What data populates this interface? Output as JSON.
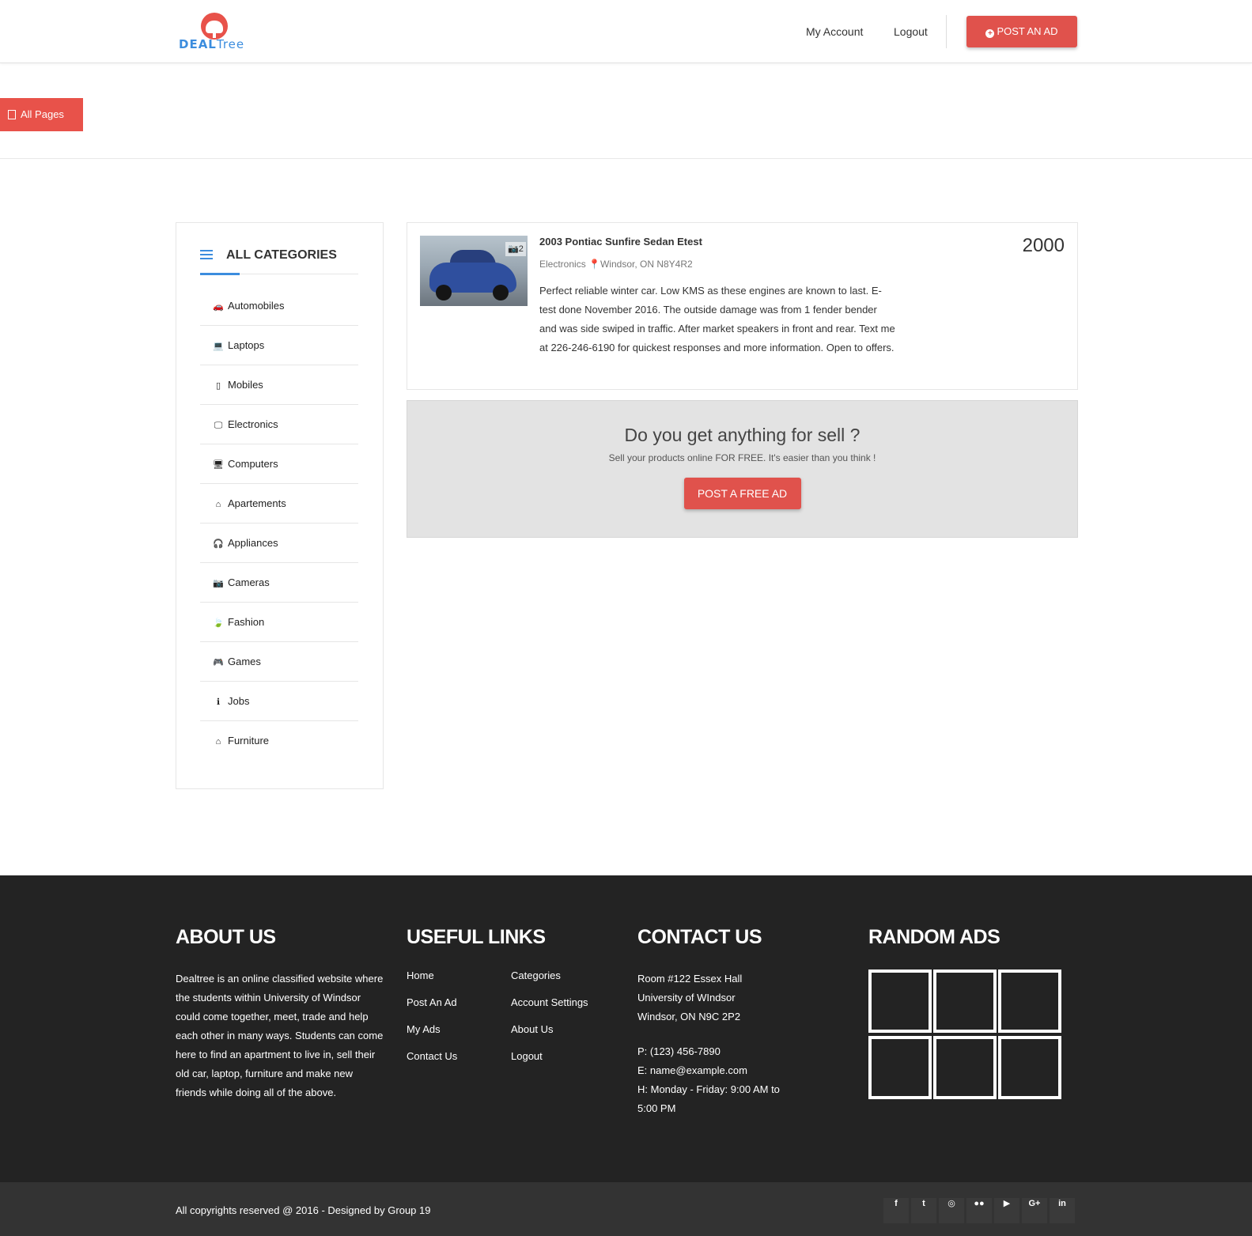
{
  "header": {
    "logo_deal": "DEAL",
    "logo_tree": "Tree",
    "my_account": "My Account",
    "logout": "Logout",
    "post_ad": "POST AN AD"
  },
  "all_pages": "All Pages",
  "sidebar": {
    "title": "ALL CATEGORIES",
    "categories": [
      {
        "icon": "car-icon",
        "glyph": "🚗",
        "label": "Automobiles"
      },
      {
        "icon": "laptop-icon",
        "glyph": "💻",
        "label": "Laptops"
      },
      {
        "icon": "mobile-icon",
        "glyph": "▯",
        "label": "Mobiles"
      },
      {
        "icon": "monitor-icon",
        "glyph": "🖵",
        "label": "Electronics"
      },
      {
        "icon": "desktop-icon",
        "glyph": "🖥",
        "label": "Computers"
      },
      {
        "icon": "home-icon",
        "glyph": "⌂",
        "label": "Apartements"
      },
      {
        "icon": "headphones-icon",
        "glyph": "🎧",
        "label": "Appliances"
      },
      {
        "icon": "camera-icon",
        "glyph": "📷",
        "label": "Cameras"
      },
      {
        "icon": "leaf-icon",
        "glyph": "🍃",
        "label": "Fashion"
      },
      {
        "icon": "gamepad-icon",
        "glyph": "🎮",
        "label": "Games"
      },
      {
        "icon": "info-icon",
        "glyph": "ℹ",
        "label": "Jobs"
      },
      {
        "icon": "home-icon",
        "glyph": "⌂",
        "label": "Furniture"
      }
    ]
  },
  "listing": {
    "title": "2003 Pontiac Sunfire Sedan Etest",
    "category": "Electronics",
    "location": "Windsor, ON N8Y4R2",
    "description": "Perfect reliable winter car. Low KMS as these engines are known to last. E-test done November 2016. The outside damage was from 1 fender bender and was side swiped in traffic. After market speakers in front and rear. Text me at 226-246-6190 for quickest responses and more information. Open to offers.",
    "price": "2000",
    "photo_count": "2"
  },
  "promo": {
    "title": "Do you get anything for sell ?",
    "subtitle": "Sell your products online FOR FREE. It's easier than you think !",
    "button": "POST A FREE AD"
  },
  "footer": {
    "about_title": "ABOUT US",
    "about_text": "Dealtree is an online classified website where the students within University of Windsor could come together, meet, trade and help each other in many ways. Students can come here to find an apartment to live in, sell their old car, laptop, furniture and make new friends while doing all of the above.",
    "links_title": "USEFUL LINKS",
    "links": [
      [
        "Home",
        "Categories"
      ],
      [
        "Post An Ad",
        "Account Settings"
      ],
      [
        "My Ads",
        "About Us"
      ],
      [
        "Contact Us",
        "Logout"
      ]
    ],
    "contact_title": "CONTACT US",
    "address_1": "Room #122 Essex Hall",
    "address_2": "University of WIndsor",
    "address_3": "Windsor, ON N9C 2P2",
    "phone": "P: (123) 456-7890",
    "email": "E: name@example.com",
    "hours_1": "H: Monday - Friday: 9:00 AM to",
    "hours_2": "5:00 PM",
    "ads_title": "RANDOM ADS"
  },
  "bottom": {
    "copyright": "All copyrights reserved @ 2016 - Designed by Group 19",
    "social": [
      {
        "icon": "facebook-icon",
        "glyph": "f"
      },
      {
        "icon": "twitter-icon",
        "glyph": "t"
      },
      {
        "icon": "dribbble-icon",
        "glyph": "◎"
      },
      {
        "icon": "flickr-icon",
        "glyph": "●●"
      },
      {
        "icon": "youtube-icon",
        "glyph": "▶"
      },
      {
        "icon": "google-plus-icon",
        "glyph": "G+"
      },
      {
        "icon": "linkedin-icon",
        "glyph": "in"
      }
    ]
  },
  "colors": {
    "accent": "#e0524c",
    "blue": "#3c8dde",
    "footer_bg": "#232323",
    "bottom_bg": "#333333"
  }
}
